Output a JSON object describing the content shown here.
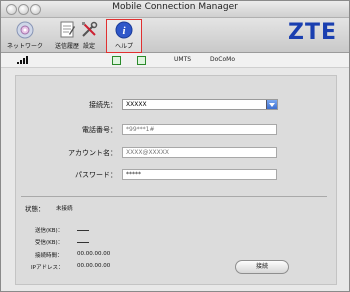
{
  "window": {
    "title": "Mobile Connection Manager"
  },
  "toolbar": {
    "items": [
      {
        "label": "ネットワーク",
        "icon": "network-icon"
      },
      {
        "label": "送信履歴",
        "icon": "history-icon"
      },
      {
        "label": "設定",
        "icon": "settings-icon"
      },
      {
        "label": "ヘルプ",
        "icon": "help-icon",
        "selected": true
      }
    ],
    "brand": "ZTE"
  },
  "status_bar": {
    "network_type": "UMTS",
    "operator": "DoCoMo"
  },
  "form": {
    "connection_label": "接続先：",
    "connection_value": "XXXXX",
    "phone_label": "電話番号：",
    "phone_value": "*99***1#",
    "account_label": "アカウント名：",
    "account_value": "XXXX@XXXXX",
    "password_label": "パスワード：",
    "password_value": "*****"
  },
  "status": {
    "state_label": "状態：",
    "state_value": "未接続",
    "sent_label": "送信(KB)：",
    "recv_label": "受信(KB)：",
    "time_label": "接続時間：",
    "time_value": "00.00.00.00",
    "ip_label": "IPアドレス：",
    "ip_value": "00.00.00.00"
  },
  "actions": {
    "connect_label": "接続"
  },
  "colors": {
    "brand": "#1a3fb0",
    "highlight": "#e03030",
    "accent_green": "#2a8a2a"
  }
}
